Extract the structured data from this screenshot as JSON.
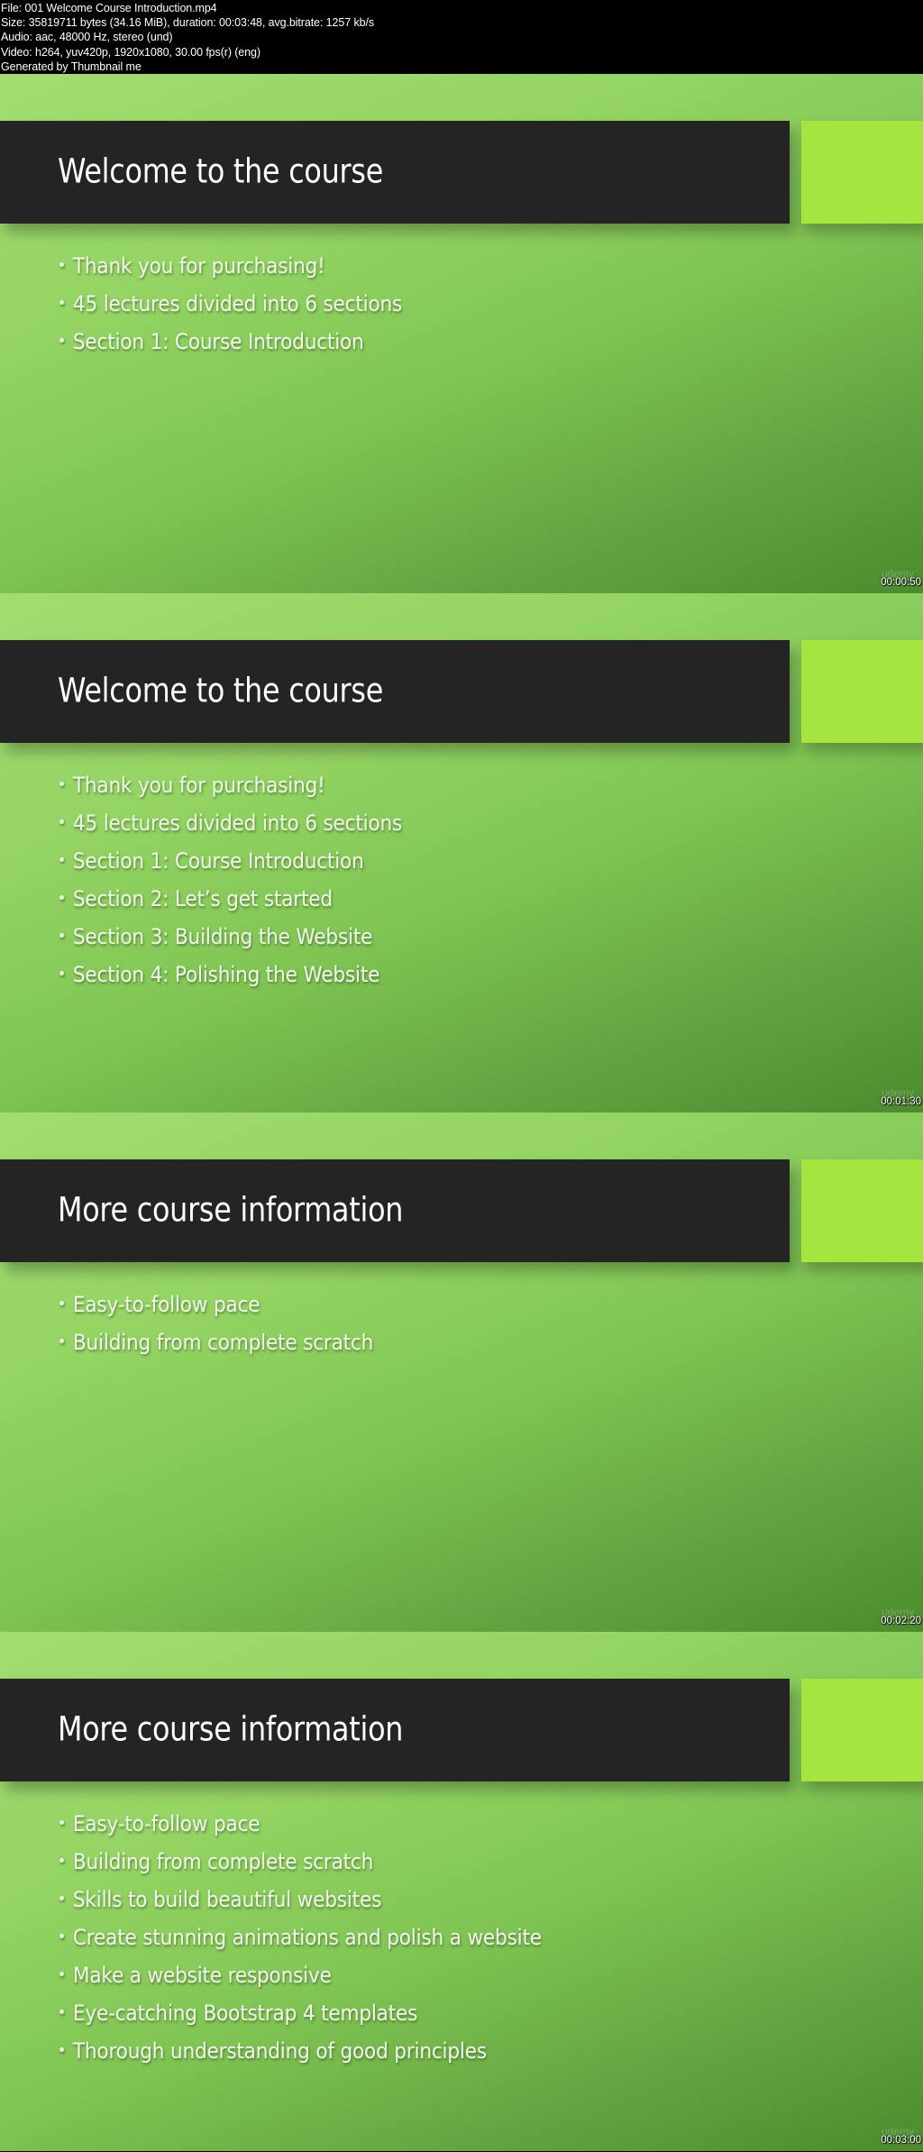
{
  "header": {
    "lines": [
      "File: 001 Welcome  Course Introduction.mp4",
      "Size: 35819711 bytes (34.16 MiB), duration: 00:03:48, avg.bitrate: 1257 kb/s",
      "Audio: aac, 48000 Hz, stereo (und)",
      "Video: h264, yuv420p, 1920x1080, 30.00 fps(r) (eng)",
      "Generated by Thumbnail me"
    ]
  },
  "frames": [
    {
      "title": "Welcome to the course",
      "bullets": [
        "Thank you for purchasing!",
        "45 lectures divided into 6 sections",
        "Section 1: Course Introduction"
      ],
      "timestamp": "00:00:50",
      "watermark": "udemy"
    },
    {
      "title": "Welcome to the course",
      "bullets": [
        "Thank you for purchasing!",
        "45 lectures divided into 6 sections",
        "Section 1: Course Introduction",
        "Section 2: Let’s get started",
        "Section 3: Building the Website",
        "Section 4: Polishing the Website"
      ],
      "timestamp": "00:01:30",
      "watermark": "udemy"
    },
    {
      "title": "More course information",
      "bullets": [
        "Easy-to-follow pace",
        "Building from complete scratch"
      ],
      "timestamp": "00:02:20",
      "watermark": "udemy"
    },
    {
      "title": "More course information",
      "bullets": [
        "Easy-to-follow pace",
        "Building from complete scratch",
        "Skills to build beautiful websites",
        "Create stunning animations and polish a website",
        "Make a website responsive",
        "Eye-catching Bootstrap 4 templates",
        "Thorough understanding of good principles"
      ],
      "timestamp": "00:03:00",
      "watermark": "udemy"
    }
  ],
  "colors": {
    "title_bar": "#242424",
    "accent_box": "#a6e440",
    "background_light": "#a1dc70",
    "background_dark": "#4a8a2c",
    "text": "#ffffff"
  },
  "bullet_icon": "bullet-dot"
}
